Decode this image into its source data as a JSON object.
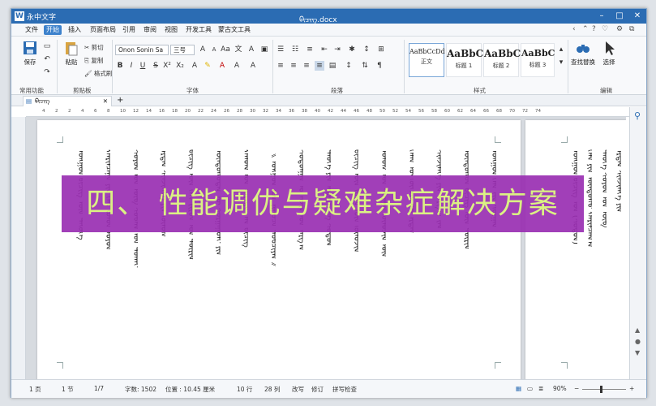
{
  "app": {
    "name": "永中文字",
    "logo_letter": "W",
    "doc_title": "ᠪᠢᠴᠢᠭ.docx"
  },
  "menu": [
    {
      "label": "文件",
      "active": false
    },
    {
      "label": "开始",
      "active": true
    },
    {
      "label": "插入",
      "active": false
    },
    {
      "label": "页面布局",
      "active": false
    },
    {
      "label": "引用",
      "active": false
    },
    {
      "label": "审阅",
      "active": false
    },
    {
      "label": "视图",
      "active": false
    },
    {
      "label": "开发工具",
      "active": false
    },
    {
      "label": "蒙古文工具",
      "active": false
    }
  ],
  "ribbon": {
    "save_label": "保存",
    "paste_label": "粘贴",
    "cut_label": "剪切",
    "copy_label": "复制",
    "format_painter_label": "格式刷",
    "font_name": "Onon Sonin Sa",
    "font_size": "三号",
    "find_replace_label": "查找替换",
    "select_label": "选择",
    "groups": {
      "common": "常用功能",
      "clipboard": "剪贴板",
      "font": "字体",
      "paragraph": "段落",
      "styles": "样式",
      "editing": "编辑"
    },
    "styles": [
      {
        "sample": "AaBbCcDd",
        "name": "正文"
      },
      {
        "sample": "AaBbC",
        "name": "标题 1"
      },
      {
        "sample": "AaBbC",
        "name": "标题 2"
      },
      {
        "sample": "AaBbC",
        "name": "标题 3"
      }
    ]
  },
  "doc_tab": {
    "label": "ᠪᠢᠴᠢᠭ",
    "add": "+"
  },
  "ruler": [
    "4",
    "2",
    "2",
    "4",
    "6",
    "8",
    "10",
    "12",
    "14",
    "16",
    "18",
    "20",
    "22",
    "24",
    "26",
    "28",
    "30",
    "32",
    "34",
    "36",
    "38",
    "40",
    "42",
    "44",
    "46",
    "48",
    "50",
    "52",
    "54",
    "56",
    "58",
    "60",
    "62",
    "64",
    "66",
    "68",
    "70",
    "72",
    "74"
  ],
  "document": {
    "columns": [
      "ᠮᠣᠩᠭᠣᠯ ᠪᠢᠴᠢᠭ ᠦᠨ ᠲᠡᠭᠦᠬᠡ",
      "ᠬᠠᠷᠢᠯᠴᠠᠭᠠ ᠶᠢᠨ ᠬᠡᠯᠡ ᠪᠣᠯᠤᠨ ᠣᠶᠤᠨ",
      "ᠰᠣᠶᠣᠯ ᠤᠨ ᠦᠪ ᠰᠤᠪᠠᠭ ᠤᠨ ᠲᠤᠬᠠᠢ",
      "ᠡᠷᠳᠡᠮ ᠰᠢᠨᠵᠢᠯᠡᠭᠡ ᠶᠢᠨ ᠬᠦᠮᠦᠰ",
      "ᠪᠢᠴᠢᠭ ᠦᠨ ᠬᠡᠯᠡ ᠵᠢᠷᠤᠮ ᠤᠨ ᠳᠦᠷᠢᠮ",
      "ᠦᠨᠳᠦᠰᠦᠲᠡᠨ ᠦ ᠰᠤᠷᠭᠠᠭᠤᠯᠢ ᠶᠢᠨ",
      "ᠬᠠᠮᠤᠭ ᠤᠨ ᠤᠷᠢᠳᠠ ᠬᠡᠯᠡ ᠪᠢᠴᠢᠭ",
      "《 ᠮᠣᠩᠭᠣᠯ ᠤᠨ ᠨᠢᠭᠤᠴᠠ ᠲᠤᠪᠴᠢᠶᠠᠨ 》",
      "ᠰᠤᠳᠤᠯᠭᠠᠨ ᠤ ᠠᠵᠢᠯ ᠤᠨ ᠠᠷᠭ᠎ᠠ",
      "ᠲᠡᠦᠬᠡ ᠶᠢᠨ ᠮᠡᠳᠡᠯᠭᠡ ᠪᠠ ᠰᠤᠳᠤᠯ",
      "ᠪᠢᠴᠢᠭ ᠦᠨ ᠵᠦᠢᠯ ᠦᠨ ᠬᠦᠮᠦᠵᠢᠯ",
      "ᠤᠯᠤᠰ ᠤᠨ ᠰᠤᠷᠭᠠᠯ ᠬᠦᠮᠦᠵᠢᠯ ᠦᠨ",
      "ᠬᠡᠯᠡᠨ ᠦ ᠬᠥᠭᠵᠢᠯ ᠪᠠ ᠡᠷᠳᠡᠮ",
      "ᠰᠢᠨᠵᠢᠯᠡᠭᠡ ᠶᠢᠨ ᠠᠷᠭ᠎ᠠ ᠵᠠᠮ",
      "ᠦᠨᠳᠦᠰᠦᠨ ᠪᠢᠴᠢᠭ ᠦᠨ ᠳᠦᠷᠢᠮ",
      "ᠮᠣᠩᠭᠣᠯ ᠬᠡᠯᠡ ᠶᠢᠨ ᠰᠤᠷᠭᠠᠯ"
    ],
    "page2_columns": [
      "ᠮᠣᠩᠭᠣᠯ ᠪᠢᠴᠢᠭ ᠤᠨ (ᠰᠤᠳᠤᠯ)",
      "ᠬᠡᠯᠡ ᠶᠢᠨ ᠦᠨᠳᠦᠰᠦ ᠬᠠᠷᠢᠯᠴᠠᠭ᠎ᠠ",
      "ᠲᠡᠦᠬᠡ ᠰᠣᠶᠣᠯ ᠤᠨ ᠦᠪ",
      "ᠡᠷᠳᠡᠮ ᠰᠢᠨᠵᠢᠯᠡᠭᠡ ᠶᠢᠨ"
    ]
  },
  "overlay_banner": "四、 性能调优与疑难杂症解决方案",
  "status": {
    "page": "1 页",
    "section": "1 节",
    "pages": "1/7",
    "words": "字数: 1502",
    "position": "位置 : 10.45 厘米",
    "line": "10 行",
    "column": "28 列",
    "revise": "改写",
    "track": "修订",
    "spell": "拼写检查",
    "zoom": "90%"
  },
  "colors": {
    "titlebar": "#2b6cb3",
    "banner_bg": "#9a2fb2",
    "banner_text": "#d9f07a",
    "active_tab": "#3d82cc"
  }
}
